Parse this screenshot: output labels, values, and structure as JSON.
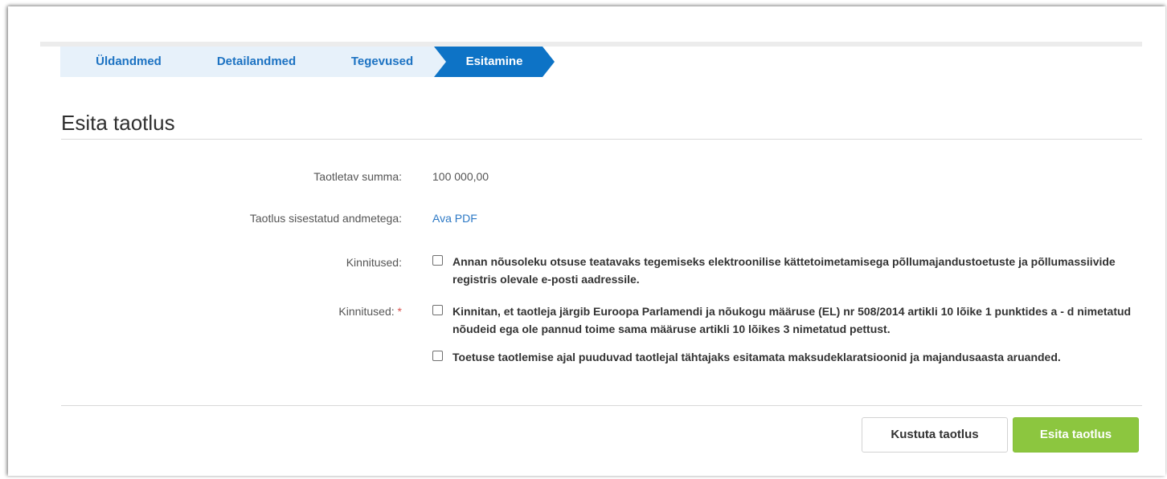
{
  "steps": [
    {
      "label": "Üldandmed"
    },
    {
      "label": "Detailandmed"
    },
    {
      "label": "Tegevused"
    },
    {
      "label": "Esitamine"
    }
  ],
  "page_title": "Esita taotlus",
  "fields": {
    "amount_label": "Taotletav summa:",
    "amount_value": "100 000,00",
    "pdf_label": "Taotlus sisestatud andmetega:",
    "pdf_link": "Ava PDF",
    "confirm_label_1": "Kinnitused:",
    "confirm_label_2": "Kinnitused:",
    "required_mark": "*"
  },
  "confirmations": [
    {
      "text": "Annan nõusoleku otsuse teatavaks tegemiseks elektroonilise kättetoimetamisega põllumajandustoetuste ja põllumassiivide registris olevale e-posti aadressile.",
      "checked": false
    },
    {
      "text": "Kinnitan, et taotleja järgib Euroopa Parlamendi ja nõukogu määruse (EL) nr 508/2014 artikli 10 lõike 1 punktides a - d nimetatud nõudeid ega ole pannud toime sama määruse artikli 10 lõikes 3 nimetatud pettust.",
      "checked": false
    },
    {
      "text": "Toetuse taotlemise ajal puuduvad taotlejal tähtajaks esitamata maksudeklaratsioonid ja majandusaasta aruanded.",
      "checked": false
    }
  ],
  "buttons": {
    "delete": "Kustuta taotlus",
    "submit": "Esita taotlus"
  },
  "colors": {
    "step_active": "#0d73c6",
    "step_inactive_bg": "#e7f1fa",
    "step_inactive_text": "#1c72c2",
    "submit_button": "#8cc63f",
    "link": "#2b78c5",
    "required": "#d9534f"
  }
}
